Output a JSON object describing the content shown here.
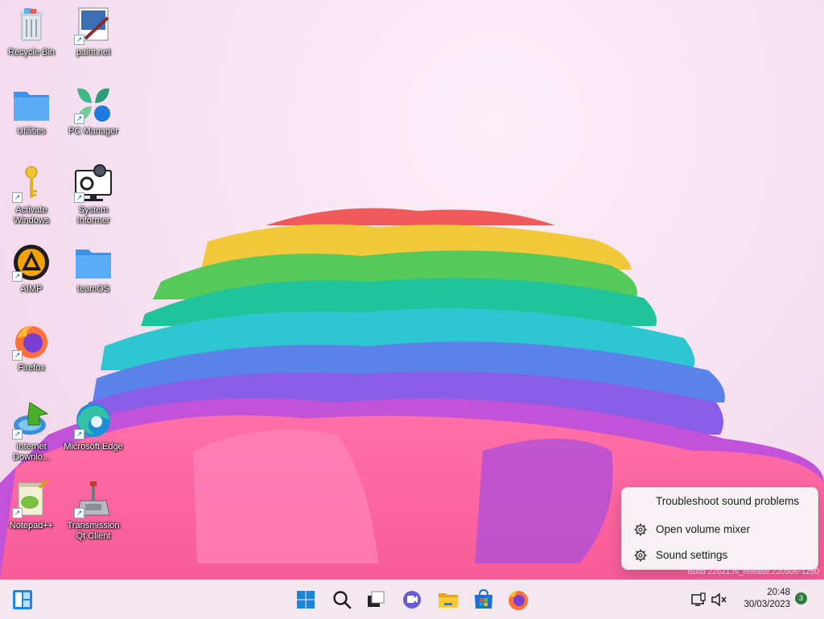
{
  "desktop": {
    "icons": [
      {
        "label": "Recycle Bin",
        "icon": "recycle-bin-icon"
      },
      {
        "label": "paint.net",
        "icon": "paintnet-icon"
      },
      {
        "label": "Utilities",
        "icon": "folder-icon"
      },
      {
        "label": "PC Manager",
        "icon": "pc-manager-icon"
      },
      {
        "label": "Activate Windows",
        "icon": "key-icon"
      },
      {
        "label": "System Informer",
        "icon": "system-informer-icon"
      },
      {
        "label": "AIMP",
        "icon": "aimp-icon"
      },
      {
        "label": "teamOS",
        "icon": "folder-icon"
      },
      {
        "label": "Firefox",
        "icon": "firefox-icon"
      },
      {
        "label": "Internet Downlo...",
        "icon": "idm-icon"
      },
      {
        "label": "Microsoft Edge",
        "icon": "edge-icon"
      },
      {
        "label": "Notepad++",
        "icon": "notepadpp-icon"
      },
      {
        "label": "Transmission Qt Client",
        "icon": "transmission-icon"
      }
    ],
    "watermark": "Build 22621.ni_release.220506-1250"
  },
  "context_menu": {
    "items": [
      {
        "label": "Troubleshoot sound problems",
        "icon": null
      },
      {
        "label": "Open volume mixer",
        "icon": "gear-icon"
      },
      {
        "label": "Sound settings",
        "icon": "gear-icon"
      }
    ]
  },
  "taskbar": {
    "left": {
      "icon": "widgets-icon"
    },
    "pinned": [
      {
        "name": "start",
        "icon": "windows-logo-icon"
      },
      {
        "name": "search",
        "icon": "search-icon"
      },
      {
        "name": "task-view",
        "icon": "task-view-icon"
      },
      {
        "name": "chat",
        "icon": "teams-chat-icon"
      },
      {
        "name": "file-explorer",
        "icon": "file-explorer-icon"
      },
      {
        "name": "store",
        "icon": "microsoft-store-icon"
      },
      {
        "name": "firefox",
        "icon": "firefox-icon"
      }
    ],
    "tray": {
      "icons": [
        "network-icon",
        "volume-muted-icon"
      ]
    },
    "clock": {
      "time": "20:48",
      "date": "30/03/2023"
    },
    "notification_count": "3"
  },
  "colors": {
    "accent": "#0067c0",
    "folder": "#4aa3f0"
  }
}
